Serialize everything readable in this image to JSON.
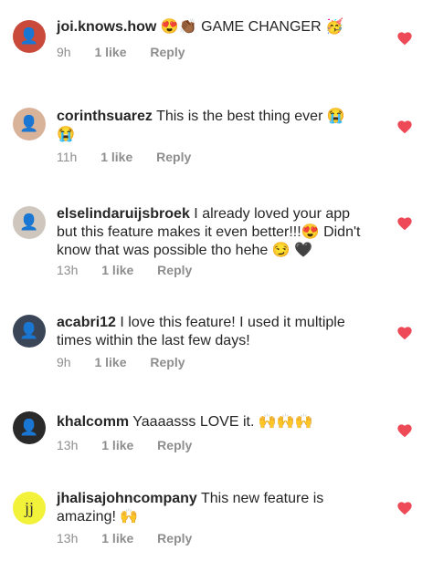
{
  "comments": [
    {
      "username": "joi.knows.how",
      "text": "😍👏🏾 GAME CHANGER 🥳",
      "time": "9h",
      "likes": "1 like",
      "reply": "Reply",
      "avatar_color": "#c94a3a",
      "avatar_icon": "person-photo"
    },
    {
      "username": "corinthsuarez",
      "text": "This is the best thing ever 😭 😭",
      "time": "11h",
      "likes": "1 like",
      "reply": "Reply",
      "avatar_color": "#d8b39a",
      "avatar_icon": "person-photo"
    },
    {
      "username": "elselindaruijsbroek",
      "text": "I already loved your app but this feature makes it even better!!!😍 Didn't know that was possible tho hehe 😏 🖤",
      "time": "13h",
      "likes": "1 like",
      "reply": "Reply",
      "avatar_color": "#cfc6bd",
      "avatar_icon": "person-photo"
    },
    {
      "username": "acabri12",
      "text": "I love this feature! I used it multiple times within the last few days!",
      "time": "9h",
      "likes": "1 like",
      "reply": "Reply",
      "avatar_color": "#3a4658",
      "avatar_icon": "person-photo"
    },
    {
      "username": "khalcomm",
      "text": "Yaaaasss LOVE it. 🙌🙌🙌",
      "time": "13h",
      "likes": "1 like",
      "reply": "Reply",
      "avatar_color": "#2a2a2a",
      "avatar_icon": "person-photo"
    },
    {
      "username": "jhalisajohncompany",
      "text": "This new feature is amazing! 🙌",
      "time": "13h",
      "likes": "1 like",
      "reply": "Reply",
      "avatar_color": "#f2f23a",
      "avatar_icon": "jj-logo",
      "avatar_text": "jj"
    }
  ],
  "colors": {
    "heart": "#ed4956",
    "meta": "#8e8e8e"
  }
}
